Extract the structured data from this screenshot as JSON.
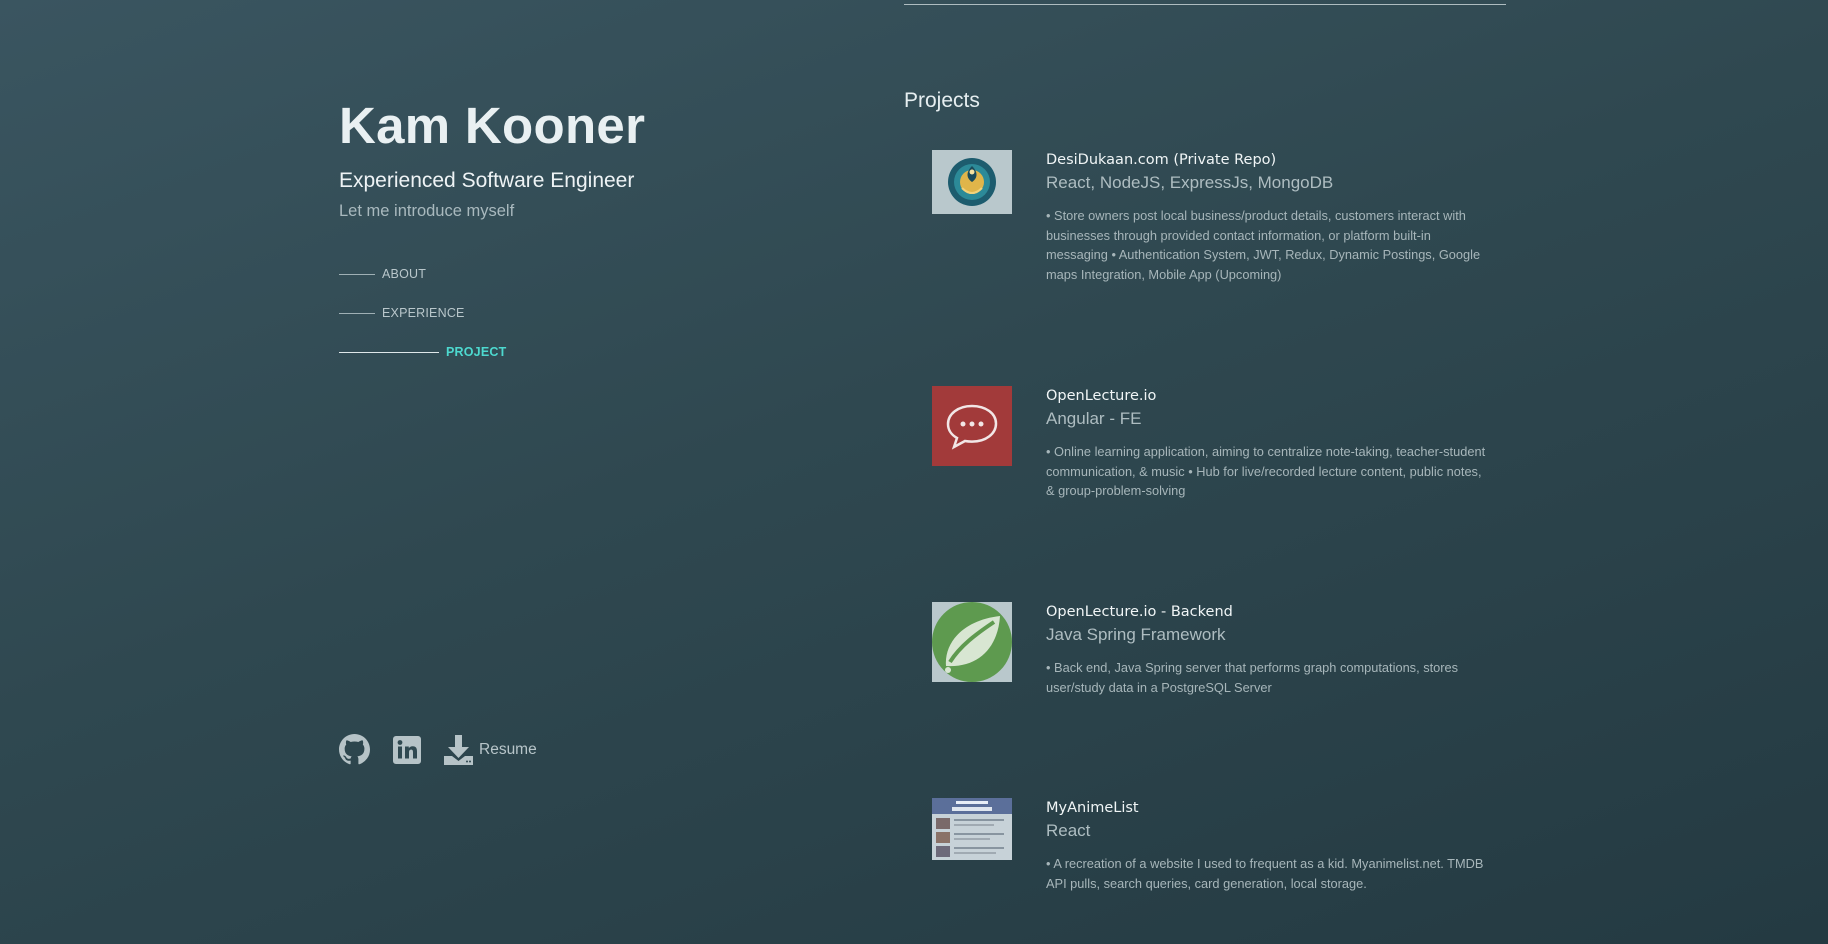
{
  "profile": {
    "name": "Kam Kooner",
    "headline": "Experienced Software Engineer",
    "intro": "Let me introduce myself"
  },
  "nav": {
    "items": [
      {
        "label": "ABOUT",
        "active": false
      },
      {
        "label": "EXPERIENCE",
        "active": false
      },
      {
        "label": "PROJECT",
        "active": true
      }
    ]
  },
  "social": {
    "github_icon": "github-icon",
    "linkedin_icon": "linkedin-icon",
    "download_icon": "download-icon",
    "resume_label": "Resume"
  },
  "projects_section": {
    "title": "Projects",
    "items": [
      {
        "title": "DesiDukaan.com (Private Repo)",
        "stack": "React, NodeJS, ExpressJs, MongoDB",
        "description": "• Store owners post local business/product details, customers interact with businesses through provided contact information, or platform built-in messaging • Authentication System, JWT, Redux, Dynamic Postings, Google maps Integration, Mobile App (Upcoming)",
        "thumb_icon": "peacock-logo-icon"
      },
      {
        "title": "OpenLecture.io",
        "stack": "Angular - FE",
        "description": "• Online learning application, aiming to centralize note-taking, teacher-student communication, & music • Hub for live/recorded lecture content, public notes, & group-problem-solving",
        "thumb_icon": "chat-bubble-icon"
      },
      {
        "title": "OpenLecture.io - Backend",
        "stack": "Java Spring Framework",
        "description": "• Back end, Java Spring server that performs graph computations, stores user/study data in a PostgreSQL Server",
        "thumb_icon": "spring-leaf-icon"
      },
      {
        "title": "MyAnimeList",
        "stack": "React",
        "description": "• A recreation of a website I used to frequent as a kid. Myanimelist.net. TMDB API pulls, search queries, card generation, local storage.",
        "thumb_icon": "website-screenshot-thumbnail"
      }
    ]
  },
  "colors": {
    "background": "#2f4850",
    "accent": "#4dd9cf",
    "chat_thumb": "#a23a3a",
    "spring_thumb": "#5e9a4f"
  }
}
